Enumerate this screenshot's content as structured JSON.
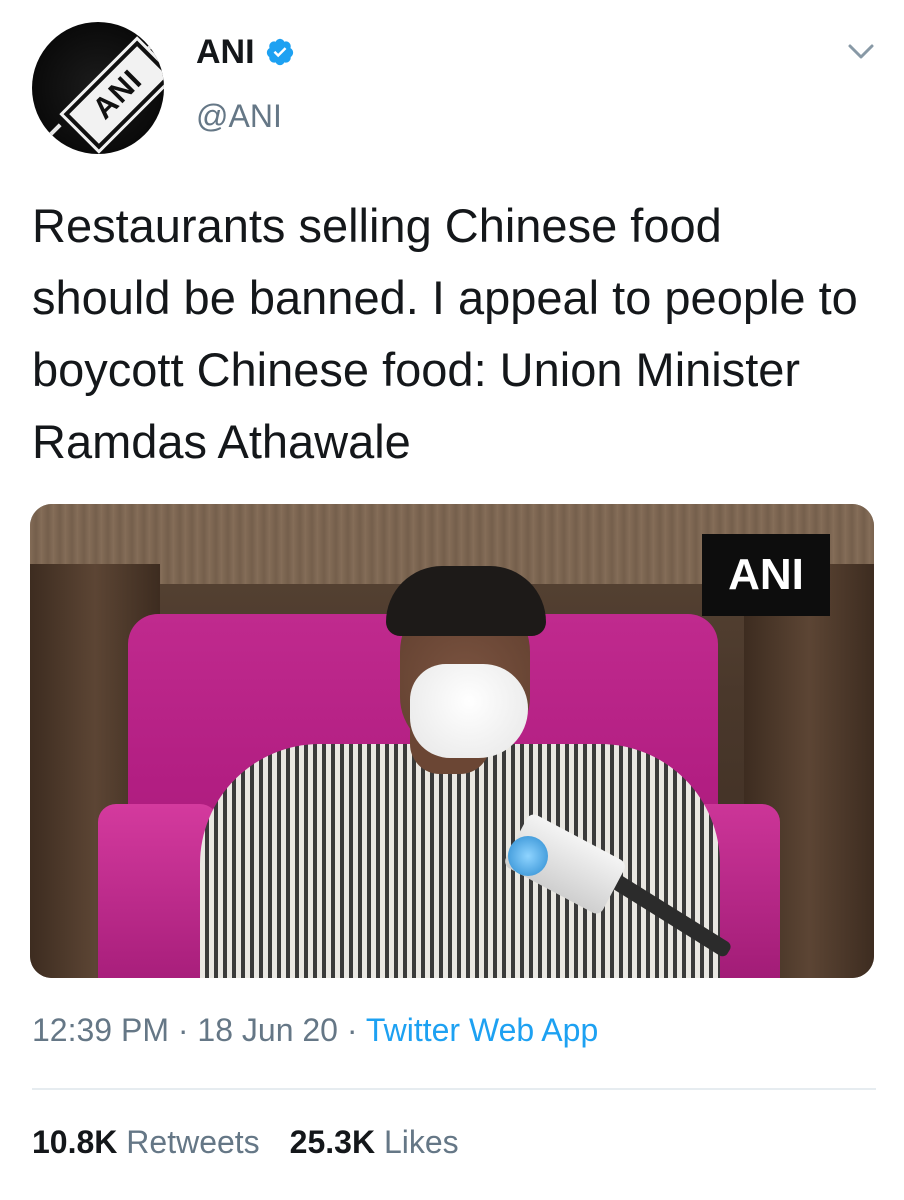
{
  "author": {
    "display_name": "ANI",
    "handle": "@ANI",
    "avatar_logo_text": "ANI",
    "verified": true
  },
  "tweet": {
    "text": "Restaurants selling Chinese food should be banned. I appeal to people to boycott Chinese food: Union Minister Ramdas Athawale"
  },
  "media": {
    "watermark_text": "ANI"
  },
  "meta": {
    "time": "12:39 PM",
    "separator1": " · ",
    "date": "18 Jun 20",
    "separator2": " · ",
    "source": "Twitter Web App"
  },
  "stats": {
    "retweets_count": "10.8K",
    "retweets_label": "Retweets",
    "likes_count": "25.3K",
    "likes_label": "Likes"
  },
  "colors": {
    "verified_blue": "#1da1f2",
    "link_blue": "#1da1f2",
    "secondary_text": "#657786",
    "primary_text": "#14171a"
  },
  "icons": {
    "verified": "verified-badge-icon",
    "menu": "chevron-down-icon"
  }
}
